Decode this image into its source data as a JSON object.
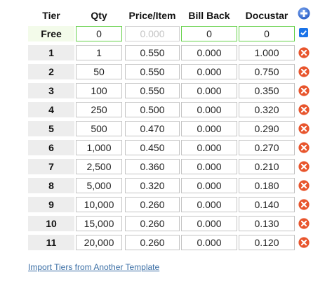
{
  "headers": {
    "tier": "Tier",
    "qty": "Qty",
    "price": "Price/Item",
    "billback": "Bill Back",
    "docustar": "Docustar"
  },
  "free_row": {
    "tier": "Free",
    "qty": "0",
    "price": "0.000",
    "billback": "0",
    "docustar": "0",
    "checked": true
  },
  "rows": [
    {
      "tier": "1",
      "qty": "1",
      "price": "0.550",
      "billback": "0.000",
      "docustar": "1.000"
    },
    {
      "tier": "2",
      "qty": "50",
      "price": "0.550",
      "billback": "0.000",
      "docustar": "0.750"
    },
    {
      "tier": "3",
      "qty": "100",
      "price": "0.550",
      "billback": "0.000",
      "docustar": "0.350"
    },
    {
      "tier": "4",
      "qty": "250",
      "price": "0.500",
      "billback": "0.000",
      "docustar": "0.320"
    },
    {
      "tier": "5",
      "qty": "500",
      "price": "0.470",
      "billback": "0.000",
      "docustar": "0.290"
    },
    {
      "tier": "6",
      "qty": "1,000",
      "price": "0.450",
      "billback": "0.000",
      "docustar": "0.270"
    },
    {
      "tier": "7",
      "qty": "2,500",
      "price": "0.360",
      "billback": "0.000",
      "docustar": "0.210"
    },
    {
      "tier": "8",
      "qty": "5,000",
      "price": "0.320",
      "billback": "0.000",
      "docustar": "0.180"
    },
    {
      "tier": "9",
      "qty": "10,000",
      "price": "0.260",
      "billback": "0.000",
      "docustar": "0.140"
    },
    {
      "tier": "10",
      "qty": "15,000",
      "price": "0.260",
      "billback": "0.000",
      "docustar": "0.130"
    },
    {
      "tier": "11",
      "qty": "20,000",
      "price": "0.260",
      "billback": "0.000",
      "docustar": "0.120"
    }
  ],
  "import_link": "Import Tiers from Another Template",
  "icons": {
    "add": "plus-circle-icon",
    "delete": "x-circle-icon"
  },
  "colors": {
    "add_blue": "#3b73d6",
    "delete_orange": "#e8552d",
    "valid_green": "#66d14a",
    "link_blue": "#3a6ea5"
  }
}
